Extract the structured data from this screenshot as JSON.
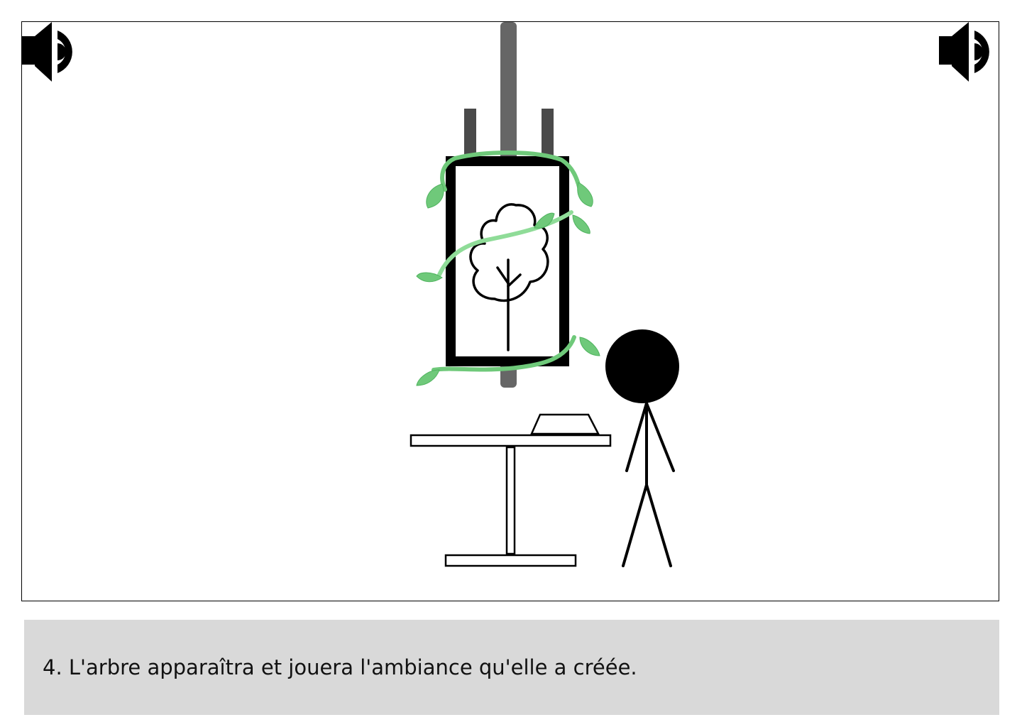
{
  "caption": {
    "text": "4. L'arbre apparaîtra et jouera l'ambiance qu'elle a créée."
  },
  "colors": {
    "vine": "#6fc97a",
    "vine_light": "#8fdc98",
    "pole": "#666666",
    "pole_dark": "#4a4a4a",
    "frame": "#000000",
    "caption_bg": "#d9d9d9"
  },
  "icons": {
    "speaker_left": "speaker-icon",
    "speaker_right": "speaker-icon",
    "tree": "tree-icon"
  }
}
